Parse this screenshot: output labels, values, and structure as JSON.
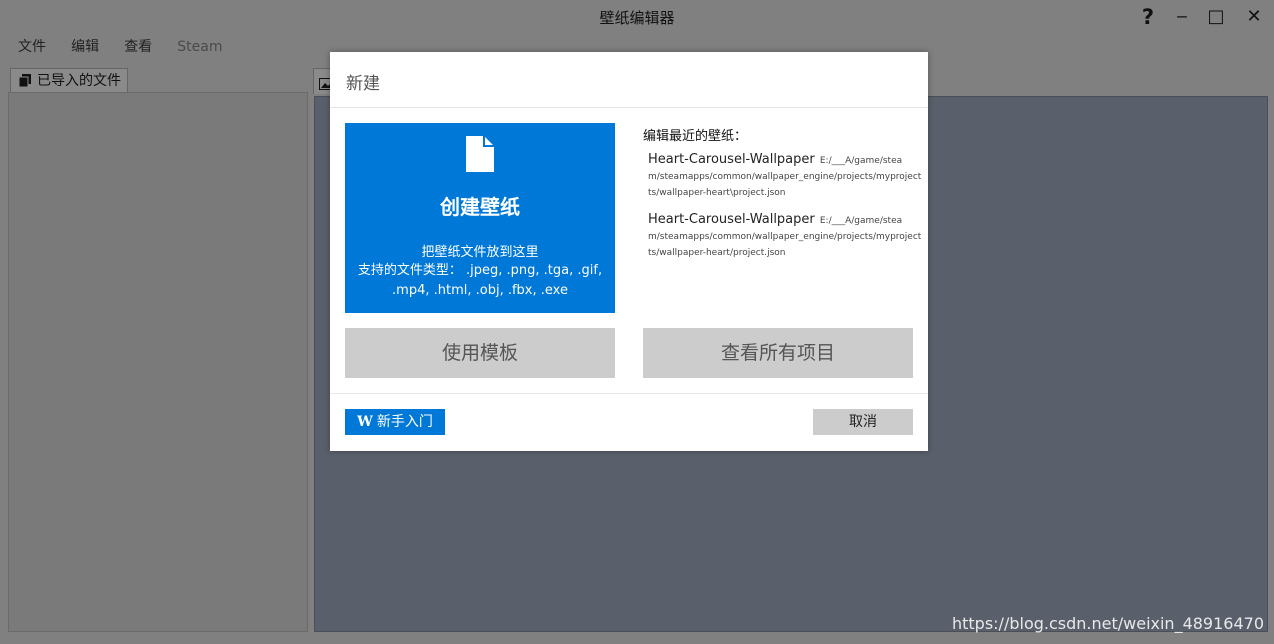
{
  "window": {
    "title": "壁纸编辑器",
    "help_icon": "?",
    "minimize_icon": "‒",
    "maximize_icon": "□",
    "close_icon": "✕"
  },
  "menubar": {
    "items": [
      "文件",
      "编辑",
      "查看",
      "Steam"
    ]
  },
  "left_panel": {
    "tab_label": "已导入的文件",
    "tab_icon": "copy-icon"
  },
  "right_panel": {
    "tab_icon": "image-icon"
  },
  "dialog": {
    "title": "新建",
    "create": {
      "icon": "document-icon",
      "title": "创建壁纸",
      "drop_hint": "把壁纸文件放到这里",
      "types_line1": "支持的文件类型： .jpeg, .png, .tga, .gif,",
      "types_line2": ".mp4, .html, .obj, .fbx, .exe"
    },
    "recent": {
      "heading": "编辑最近的壁纸：",
      "items": [
        {
          "name": "Heart-Carousel-Wallpaper",
          "path1": "E:/___A/game/stea",
          "path2": "m/steamapps/common/wallpaper_engine/projects/myproject",
          "path3": "ts/wallpaper-heart\\project.json"
        },
        {
          "name": "Heart-Carousel-Wallpaper",
          "path1": "E:/___A/game/stea",
          "path2": "m/steamapps/common/wallpaper_engine/projects/myproject",
          "path3": "ts/wallpaper-heart/project.json"
        }
      ]
    },
    "template_button": "使用模板",
    "view_all_button": "查看所有项目",
    "guide_icon": "W",
    "guide_button": "新手入门",
    "cancel_button": "取消",
    "accent_color": "#0078d7"
  },
  "watermark": "https://blog.csdn.net/weixin_48916470"
}
